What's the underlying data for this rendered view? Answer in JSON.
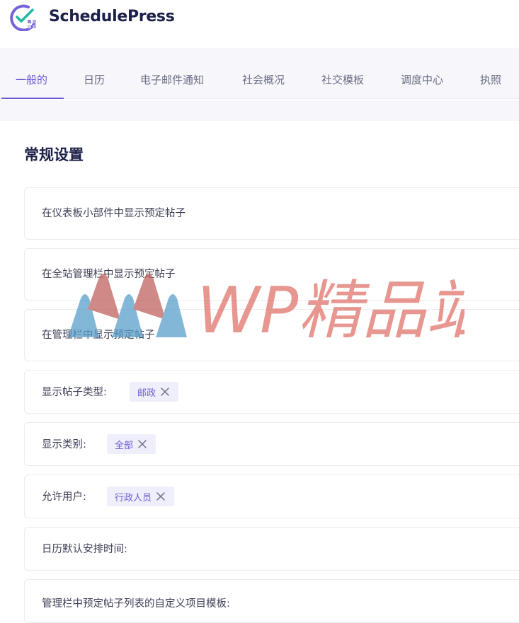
{
  "app": {
    "name": "SchedulePress",
    "logo_icon": "schedulepress-logo-icon"
  },
  "tabs": [
    {
      "label": "一般的",
      "active": true
    },
    {
      "label": "日历"
    },
    {
      "label": "电子邮件通知"
    },
    {
      "label": "社会概况"
    },
    {
      "label": "社交模板"
    },
    {
      "label": "调度中心"
    },
    {
      "label": "执照"
    }
  ],
  "section": {
    "title": "常规设置"
  },
  "settings": [
    {
      "label": "在仪表板小部件中显示预定帖子"
    },
    {
      "label": "在全站管理栏中显示预定帖子"
    },
    {
      "label": "在管理栏中显示预定帖子"
    },
    {
      "label": "显示帖子类型:",
      "tag": "邮政"
    },
    {
      "label": "显示类别:",
      "tag": "全部"
    },
    {
      "label": "允许用户:",
      "tag": "行政人员"
    },
    {
      "label": "日历默认安排时间:"
    },
    {
      "label": "管理栏中预定帖子列表的自定义项目模板:"
    }
  ],
  "watermark": {
    "text": "WP精品站"
  },
  "colors": {
    "accent": "#6e5bd4",
    "title": "#1d2048",
    "logo_teal": "#1fb8a4",
    "watermark_red": "#e0736b",
    "watermark_blue": "#5aa0cc"
  }
}
